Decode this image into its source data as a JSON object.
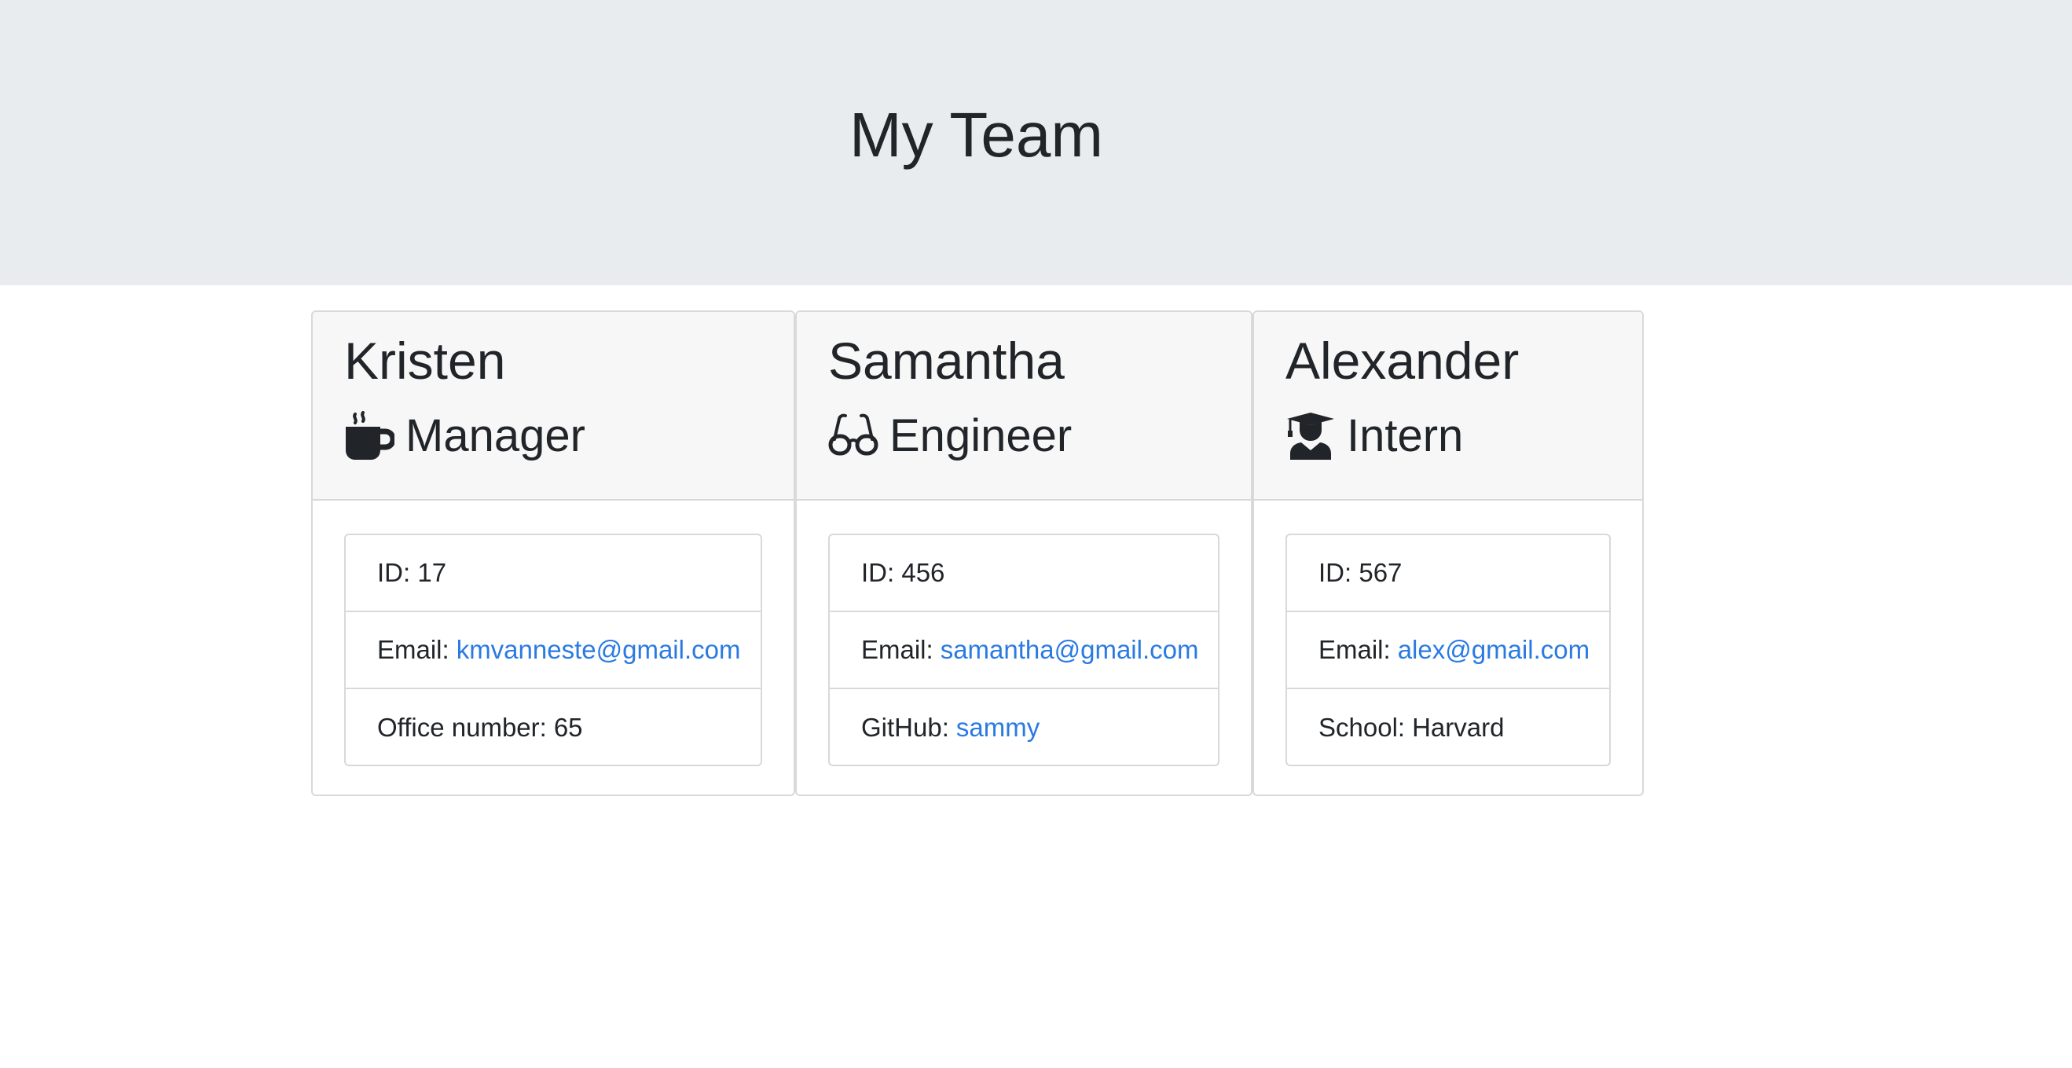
{
  "header": {
    "title": "My Team"
  },
  "team": [
    {
      "name": "Kristen",
      "role": "Manager",
      "role_icon": "coffee-mug-icon",
      "id_label": "ID: 17",
      "email_label": "Email:",
      "email": "kmvanneste@gmail.com",
      "extra_label": "Office number:",
      "extra_value": "65"
    },
    {
      "name": "Samantha",
      "role": "Engineer",
      "role_icon": "glasses-icon",
      "id_label": "ID: 456",
      "email_label": "Email:",
      "email": "samantha@gmail.com",
      "extra_label": "GitHub:",
      "extra_value": "sammy"
    },
    {
      "name": "Alexander",
      "role": "Intern",
      "role_icon": "graduate-icon",
      "id_label": "ID: 567",
      "email_label": "Email:",
      "email": "alex@gmail.com",
      "extra_label": "School:",
      "extra_value": "Harvard"
    }
  ],
  "colors": {
    "header_bg": "#e9ecef",
    "card_header_bg": "#f7f7f7",
    "link": "#2a7ae2",
    "text": "#212529",
    "border": "#d9d9d9"
  }
}
